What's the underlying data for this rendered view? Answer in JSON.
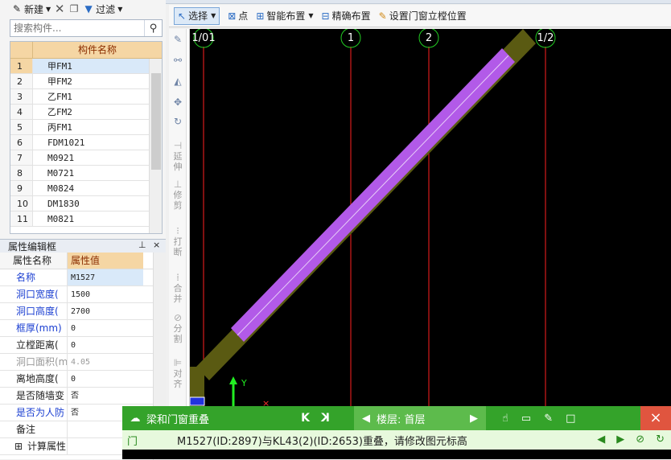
{
  "left_toolbar": {
    "new_label": "新建",
    "filter_label": "过滤"
  },
  "search": {
    "placeholder": "搜索构件..."
  },
  "component_table": {
    "header": "构件名称",
    "rows": [
      {
        "num": "1",
        "name": "甲FM1"
      },
      {
        "num": "2",
        "name": "甲FM2"
      },
      {
        "num": "3",
        "name": "乙FM1"
      },
      {
        "num": "4",
        "name": "乙FM2"
      },
      {
        "num": "5",
        "name": "丙FM1"
      },
      {
        "num": "6",
        "name": "FDM1021"
      },
      {
        "num": "7",
        "name": "M0921"
      },
      {
        "num": "8",
        "name": "M0721"
      },
      {
        "num": "9",
        "name": "M0824"
      },
      {
        "num": "10",
        "name": "DM1830"
      },
      {
        "num": "11",
        "name": "M0821"
      }
    ]
  },
  "property_panel": {
    "title": "属性编辑框",
    "pin": "ᵖ",
    "close": "×",
    "col_name": "属性名称",
    "col_value": "属性值",
    "rows": [
      {
        "name": "名称",
        "value": "M1527"
      },
      {
        "name": "洞口宽度(",
        "value": "1500"
      },
      {
        "name": "洞口高度(",
        "value": "2700"
      },
      {
        "name": "框厚(mm)",
        "value": "0"
      },
      {
        "name": "立樘距离(",
        "value": "0"
      },
      {
        "name": "洞口面积(m",
        "value": "4.05"
      },
      {
        "name": "离地高度(",
        "value": "0"
      },
      {
        "name": "是否随墙变",
        "value": "否"
      },
      {
        "name": "是否为人防",
        "value": "否"
      },
      {
        "name": "备注",
        "value": ""
      },
      {
        "name": "计算属性",
        "value": ""
      }
    ]
  },
  "toolbar": {
    "select_label": "选择",
    "point_label": "点",
    "smart_layout_label": "智能布置",
    "precise_layout_label": "精确布置",
    "set_door_window_label": "设置门窗立樘位置"
  },
  "vertical_tools": {
    "extend": "延伸",
    "trim": "修剪",
    "break": "打断",
    "merge": "合并",
    "split": "分割",
    "align": "对齐"
  },
  "canvas": {
    "axis_labels": [
      "1/01",
      "1",
      "2",
      "1/2"
    ],
    "ucs_y": "Y"
  },
  "notification": {
    "title": "梁和门窗重叠",
    "prev": "K",
    "next": "K",
    "floor_label": "楼层: 首层",
    "close": "×",
    "type": "门",
    "message": "M1527(ID:2897)与KL43(2)(ID:2653)重叠，请修改图元标高"
  },
  "colors": {
    "canvas_bg": "#000000",
    "axis_line": "#ff2020",
    "axis_bubble": "#22cc22",
    "beam": "#5a5a12",
    "door": "#b25ae8",
    "notify_green": "#34a32a",
    "header_orange": "#f5d6a4"
  }
}
